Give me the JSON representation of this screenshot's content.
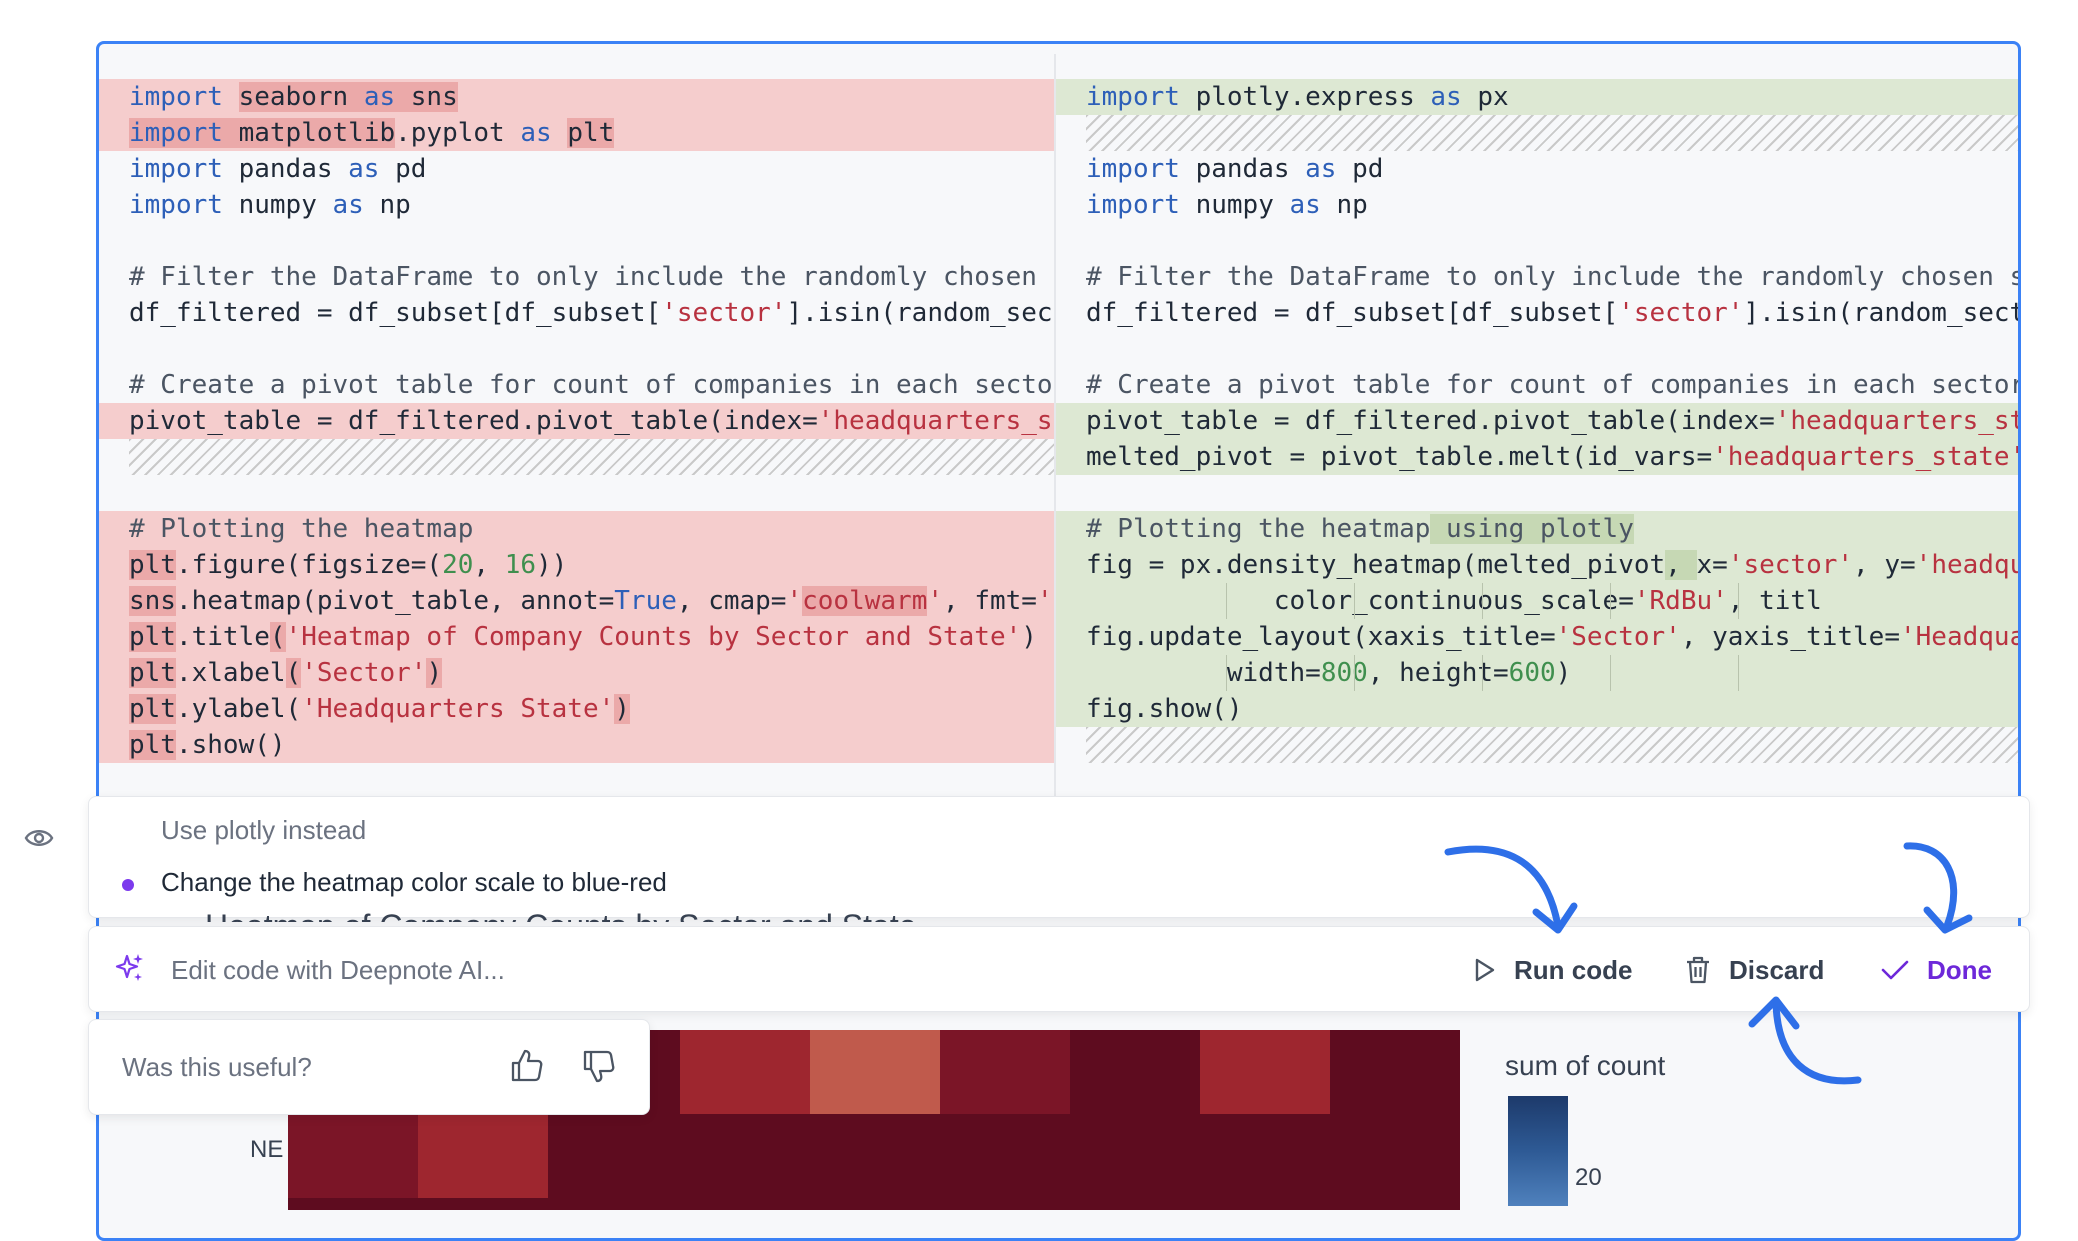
{
  "diff": {
    "left": [
      {
        "type": "del",
        "parts": [
          {
            "t": "import",
            "c": "kw"
          },
          {
            "t": " "
          },
          {
            "t": "seaborn ",
            "c": "hl-del"
          },
          {
            "t": "as",
            "c": "kw hl-del"
          },
          {
            "t": " sns",
            "c": "hl-del"
          }
        ]
      },
      {
        "type": "del",
        "parts": [
          {
            "t": "import",
            "c": "kw hl-del"
          },
          {
            "t": " matplotlib",
            "c": "hl-del"
          },
          {
            "t": ".pyplot "
          },
          {
            "t": "as",
            "c": "kw"
          },
          {
            "t": " "
          },
          {
            "t": "plt",
            "c": "hl-del"
          }
        ]
      },
      {
        "type": "ctx",
        "parts": [
          {
            "t": "import",
            "c": "kw"
          },
          {
            "t": " pandas "
          },
          {
            "t": "as",
            "c": "kw"
          },
          {
            "t": " pd"
          }
        ]
      },
      {
        "type": "ctx",
        "parts": [
          {
            "t": "import",
            "c": "kw"
          },
          {
            "t": " numpy "
          },
          {
            "t": "as",
            "c": "kw"
          },
          {
            "t": " np"
          }
        ]
      },
      {
        "type": "ctx",
        "parts": []
      },
      {
        "type": "ctx",
        "parts": [
          {
            "t": "# Filter the DataFrame to only include the randomly chosen s",
            "c": "cm"
          }
        ]
      },
      {
        "type": "ctx",
        "parts": [
          {
            "t": "df_filtered = df_subset[df_subset["
          },
          {
            "t": "'sector'",
            "c": "st"
          },
          {
            "t": "].isin(random_sect"
          }
        ]
      },
      {
        "type": "ctx",
        "parts": []
      },
      {
        "type": "ctx",
        "parts": [
          {
            "t": "# Create a pivot table for count of companies in each sector",
            "c": "cm"
          }
        ]
      },
      {
        "type": "del",
        "parts": [
          {
            "t": "pivot_table = df_filtered.pivot_table(index="
          },
          {
            "t": "'headquarters_st",
            "c": "st"
          }
        ]
      },
      {
        "type": "pad",
        "parts": []
      },
      {
        "type": "ctx",
        "parts": []
      },
      {
        "type": "del",
        "parts": [
          {
            "t": "# Plotting the heatmap",
            "c": "cm"
          }
        ]
      },
      {
        "type": "del",
        "parts": [
          {
            "t": "plt",
            "c": "hl-del"
          },
          {
            "t": ".figure(figsize=("
          },
          {
            "t": "20",
            "c": "nm"
          },
          {
            "t": ", "
          },
          {
            "t": "16",
            "c": "nm"
          },
          {
            "t": "))"
          }
        ]
      },
      {
        "type": "del",
        "parts": [
          {
            "t": "sns",
            "c": "hl-del"
          },
          {
            "t": ".heatmap(pivot_table, annot="
          },
          {
            "t": "True",
            "c": "kw"
          },
          {
            "t": ", cmap="
          },
          {
            "t": "'",
            "c": "st"
          },
          {
            "t": "coolwarm",
            "c": "st hl-del"
          },
          {
            "t": "'",
            "c": "st"
          },
          {
            "t": ", fmt="
          },
          {
            "t": "'d",
            "c": "st"
          }
        ]
      },
      {
        "type": "del",
        "parts": [
          {
            "t": "plt",
            "c": "hl-del"
          },
          {
            "t": ".title"
          },
          {
            "t": "(",
            "c": "hl-del"
          },
          {
            "t": "'Heatmap of Company Counts by Sector and State'",
            "c": "st"
          },
          {
            "t": ")"
          }
        ]
      },
      {
        "type": "del",
        "parts": [
          {
            "t": "plt",
            "c": "hl-del"
          },
          {
            "t": ".xlabel"
          },
          {
            "t": "(",
            "c": "hl-del"
          },
          {
            "t": "'Sector'",
            "c": "st"
          },
          {
            "t": ")",
            "c": "hl-del"
          }
        ]
      },
      {
        "type": "del",
        "parts": [
          {
            "t": "plt",
            "c": "hl-del"
          },
          {
            "t": ".ylabel("
          },
          {
            "t": "'Headquarters State'",
            "c": "st"
          },
          {
            "t": ")",
            "c": "hl-del"
          }
        ]
      },
      {
        "type": "del",
        "parts": [
          {
            "t": "plt",
            "c": "hl-del"
          },
          {
            "t": ".show()"
          }
        ]
      }
    ],
    "right": [
      {
        "type": "add",
        "parts": [
          {
            "t": "import",
            "c": "kw"
          },
          {
            "t": " plotly.express "
          },
          {
            "t": "as",
            "c": "kw"
          },
          {
            "t": " px"
          }
        ]
      },
      {
        "type": "pad",
        "parts": []
      },
      {
        "type": "ctx",
        "parts": [
          {
            "t": "import",
            "c": "kw"
          },
          {
            "t": " pandas "
          },
          {
            "t": "as",
            "c": "kw"
          },
          {
            "t": " pd"
          }
        ]
      },
      {
        "type": "ctx",
        "parts": [
          {
            "t": "import",
            "c": "kw"
          },
          {
            "t": " numpy "
          },
          {
            "t": "as",
            "c": "kw"
          },
          {
            "t": " np"
          }
        ]
      },
      {
        "type": "ctx",
        "parts": []
      },
      {
        "type": "ctx",
        "parts": [
          {
            "t": "# Filter the DataFrame to only include the randomly chosen s",
            "c": "cm"
          }
        ]
      },
      {
        "type": "ctx",
        "parts": [
          {
            "t": "df_filtered = df_subset[df_subset["
          },
          {
            "t": "'sector'",
            "c": "st"
          },
          {
            "t": "].isin(random_sect"
          }
        ]
      },
      {
        "type": "ctx",
        "parts": []
      },
      {
        "type": "ctx",
        "parts": [
          {
            "t": "# Create a pivot table for count of companies in each sector",
            "c": "cm"
          }
        ]
      },
      {
        "type": "add",
        "parts": [
          {
            "t": "pivot_table = df_filtered.pivot_table(index="
          },
          {
            "t": "'headquarters_st",
            "c": "st"
          }
        ]
      },
      {
        "type": "add",
        "parts": [
          {
            "t": "melted_pivot = pivot_table.melt(id_vars="
          },
          {
            "t": "'headquarters_state'",
            "c": "st"
          }
        ]
      },
      {
        "type": "ctx",
        "parts": []
      },
      {
        "type": "add",
        "parts": [
          {
            "t": "# Plotting the heatmap",
            "c": "cm"
          },
          {
            "t": " using plotly",
            "c": "cm hl-add"
          }
        ]
      },
      {
        "type": "add",
        "parts": [
          {
            "t": "fig = px.density_heatmap(melted_pivot"
          },
          {
            "t": ", ",
            "c": "hl-add"
          },
          {
            "t": "x="
          },
          {
            "t": "'sector'",
            "c": "st"
          },
          {
            "t": ", y="
          },
          {
            "t": "'headqu",
            "c": "st"
          }
        ]
      },
      {
        "type": "add",
        "guides": true,
        "parts": [
          {
            "t": "            color_continuous_scale="
          },
          {
            "t": "'RdBu'",
            "c": "st"
          },
          {
            "t": ", titl"
          }
        ]
      },
      {
        "type": "add",
        "parts": [
          {
            "t": "fig.update_layout(xaxis_title="
          },
          {
            "t": "'Sector'",
            "c": "st"
          },
          {
            "t": ", yaxis_title="
          },
          {
            "t": "'Headqua",
            "c": "st"
          }
        ]
      },
      {
        "type": "add",
        "guides": true,
        "parts": [
          {
            "t": "         width="
          },
          {
            "t": "800",
            "c": "nm"
          },
          {
            "t": ", height="
          },
          {
            "t": "600",
            "c": "nm"
          },
          {
            "t": ")"
          }
        ]
      },
      {
        "type": "add",
        "parts": [
          {
            "t": "fig.show()"
          }
        ]
      },
      {
        "type": "pad",
        "parts": []
      }
    ]
  },
  "history": {
    "prompt": "Use plotly instead",
    "current": "Change the heatmap color scale to blue-red"
  },
  "chart_ghost_title": "Heatmap of Company Counts by Sector and State",
  "ai_bar": {
    "placeholder": "Edit code with Deepnote AI...",
    "run_label": "Run code",
    "discard_label": "Discard",
    "done_label": "Done"
  },
  "feedback": {
    "label": "Was this useful?"
  },
  "chart": {
    "y_tick": "NE",
    "legend_title": "sum of count",
    "legend_tick": "20"
  },
  "colors": {
    "accent": "#3b82f6",
    "done": "#6d28d9",
    "deleted": "#f5cdcd",
    "added": "#dde8d3",
    "arrow": "#2e6fe8"
  }
}
